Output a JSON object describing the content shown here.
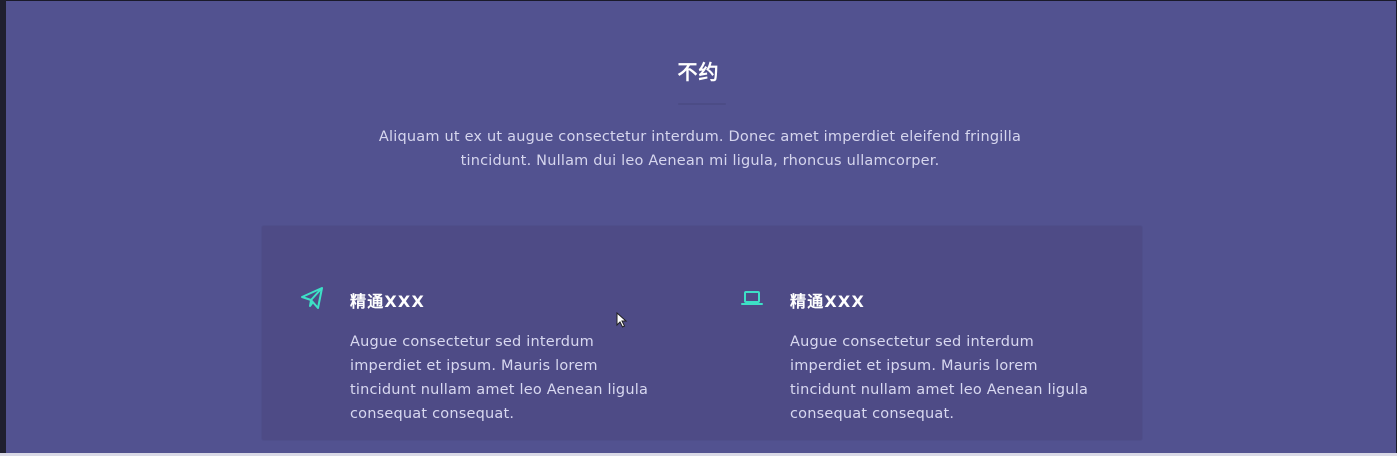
{
  "section": {
    "title": "不约",
    "intro": "Aliquam ut ex ut augue consectetur interdum. Donec amet imperdiet eleifend fringilla tincidunt. Nullam dui leo Aenean mi ligula, rhoncus ullamcorper."
  },
  "features": [
    {
      "icon": "paper-plane-icon",
      "heading": "精通XXX",
      "description": "Augue consectetur sed interdum imperdiet et ipsum. Mauris lorem tincidunt nullam amet leo Aenean ligula consequat consequat."
    },
    {
      "icon": "laptop-icon",
      "heading": "精通XXX",
      "description": "Augue consectetur sed interdum imperdiet et ipsum. Mauris lorem tincidunt nullam amet leo Aenean ligula consequat consequat."
    }
  ],
  "colors": {
    "background": "#525290",
    "panel": "#4e4b86",
    "accent": "#3de0c6",
    "text": "#d8d8f0",
    "title": "#ffffff"
  }
}
